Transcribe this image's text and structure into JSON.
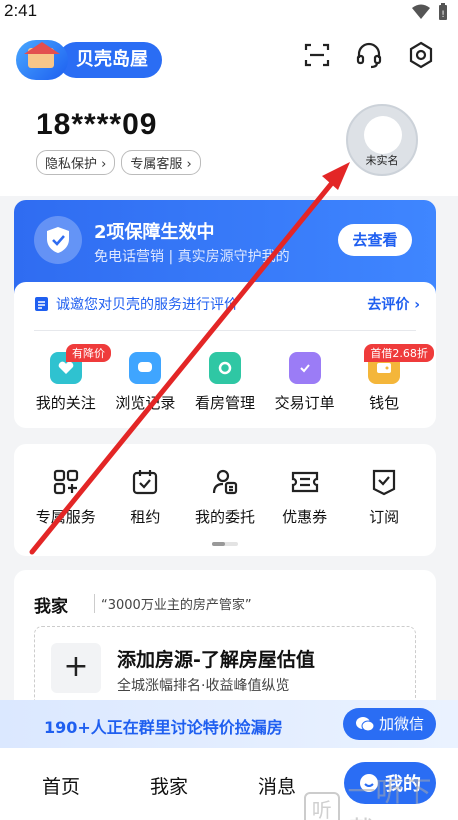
{
  "status": {
    "time": "2:41"
  },
  "header": {
    "logo_text": "贝壳岛屋",
    "phone": "18****09",
    "chips": [
      "隐私保护 ›",
      "专属客服 ›"
    ],
    "avatar_label": "未实名"
  },
  "guarantee": {
    "title": "2项保障生效中",
    "subtitle": "免电话营销 | 真实房源守护我的",
    "button": "去查看"
  },
  "evaluation": {
    "text": "诚邀您对贝壳的服务进行评价",
    "link": "去评价 ›"
  },
  "shortcuts": [
    {
      "label": "我的关注",
      "badge": "有降价",
      "icon": "heart-icon",
      "color": "#2fc2d0"
    },
    {
      "label": "浏览记录",
      "badge": "",
      "icon": "message-icon",
      "color": "#3fa5ff"
    },
    {
      "label": "看房管理",
      "badge": "",
      "icon": "camera-icon",
      "color": "#2fc7a4"
    },
    {
      "label": "交易订单",
      "badge": "",
      "icon": "clipboard-icon",
      "color": "#9b7cf6"
    },
    {
      "label": "钱包",
      "badge": "首借2.68折",
      "icon": "wallet-icon",
      "color": "#f4b63a"
    }
  ],
  "services": [
    {
      "label": "专属服务",
      "icon": "grid-icon"
    },
    {
      "label": "租约",
      "icon": "calendar-icon"
    },
    {
      "label": "我的委托",
      "icon": "user-doc-icon"
    },
    {
      "label": "优惠券",
      "icon": "ticket-icon"
    },
    {
      "label": "订阅",
      "icon": "bookmark-icon"
    }
  ],
  "home": {
    "title": "我家",
    "subtitle": "“3000万业主的房产管家”",
    "add_title": "添加房源-了解房屋估值",
    "add_sub": "全城涨幅排名·收益峰值纵览"
  },
  "group": {
    "text": "190+人正在群里讨论特价捡漏房",
    "button": "加微信"
  },
  "nav": {
    "home": "首页",
    "myhome": "我家",
    "messages": "消息",
    "me": "我的"
  },
  "watermark": {
    "glyph": "听",
    "text": "一听下载"
  },
  "colors": {
    "accent": "#2a6df4",
    "badge": "#ef3b3b",
    "annotation_arrow": "#e32626"
  }
}
